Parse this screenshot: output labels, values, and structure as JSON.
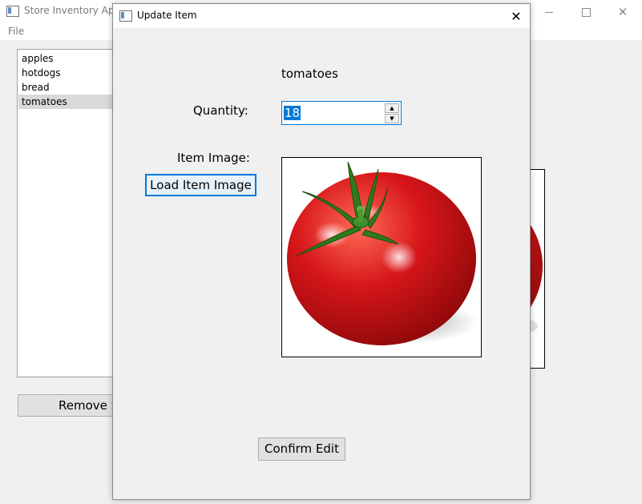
{
  "main_window": {
    "title": "Store Inventory Appl",
    "menu": {
      "file": "File"
    },
    "items": [
      {
        "label": "apples",
        "selected": false
      },
      {
        "label": "hotdogs",
        "selected": false
      },
      {
        "label": "bread",
        "selected": false
      },
      {
        "label": "tomatoes",
        "selected": true
      }
    ],
    "remove_button_label": "Remove S"
  },
  "dialog": {
    "title": "Update Item",
    "close_symbol": "✕",
    "item_name": "tomatoes",
    "quantity_label": "Quantity:",
    "quantity_value": "18",
    "spin_up": "▲",
    "spin_down": "▼",
    "item_image_label": "Item Image:",
    "load_image_button": "Load Item Image",
    "image_subject": "tomato-image",
    "confirm_button": "Confirm Edit"
  },
  "colors": {
    "accent": "#0078d7",
    "window_bg": "#f0f0f0",
    "tomato_red": "#d7161a"
  }
}
